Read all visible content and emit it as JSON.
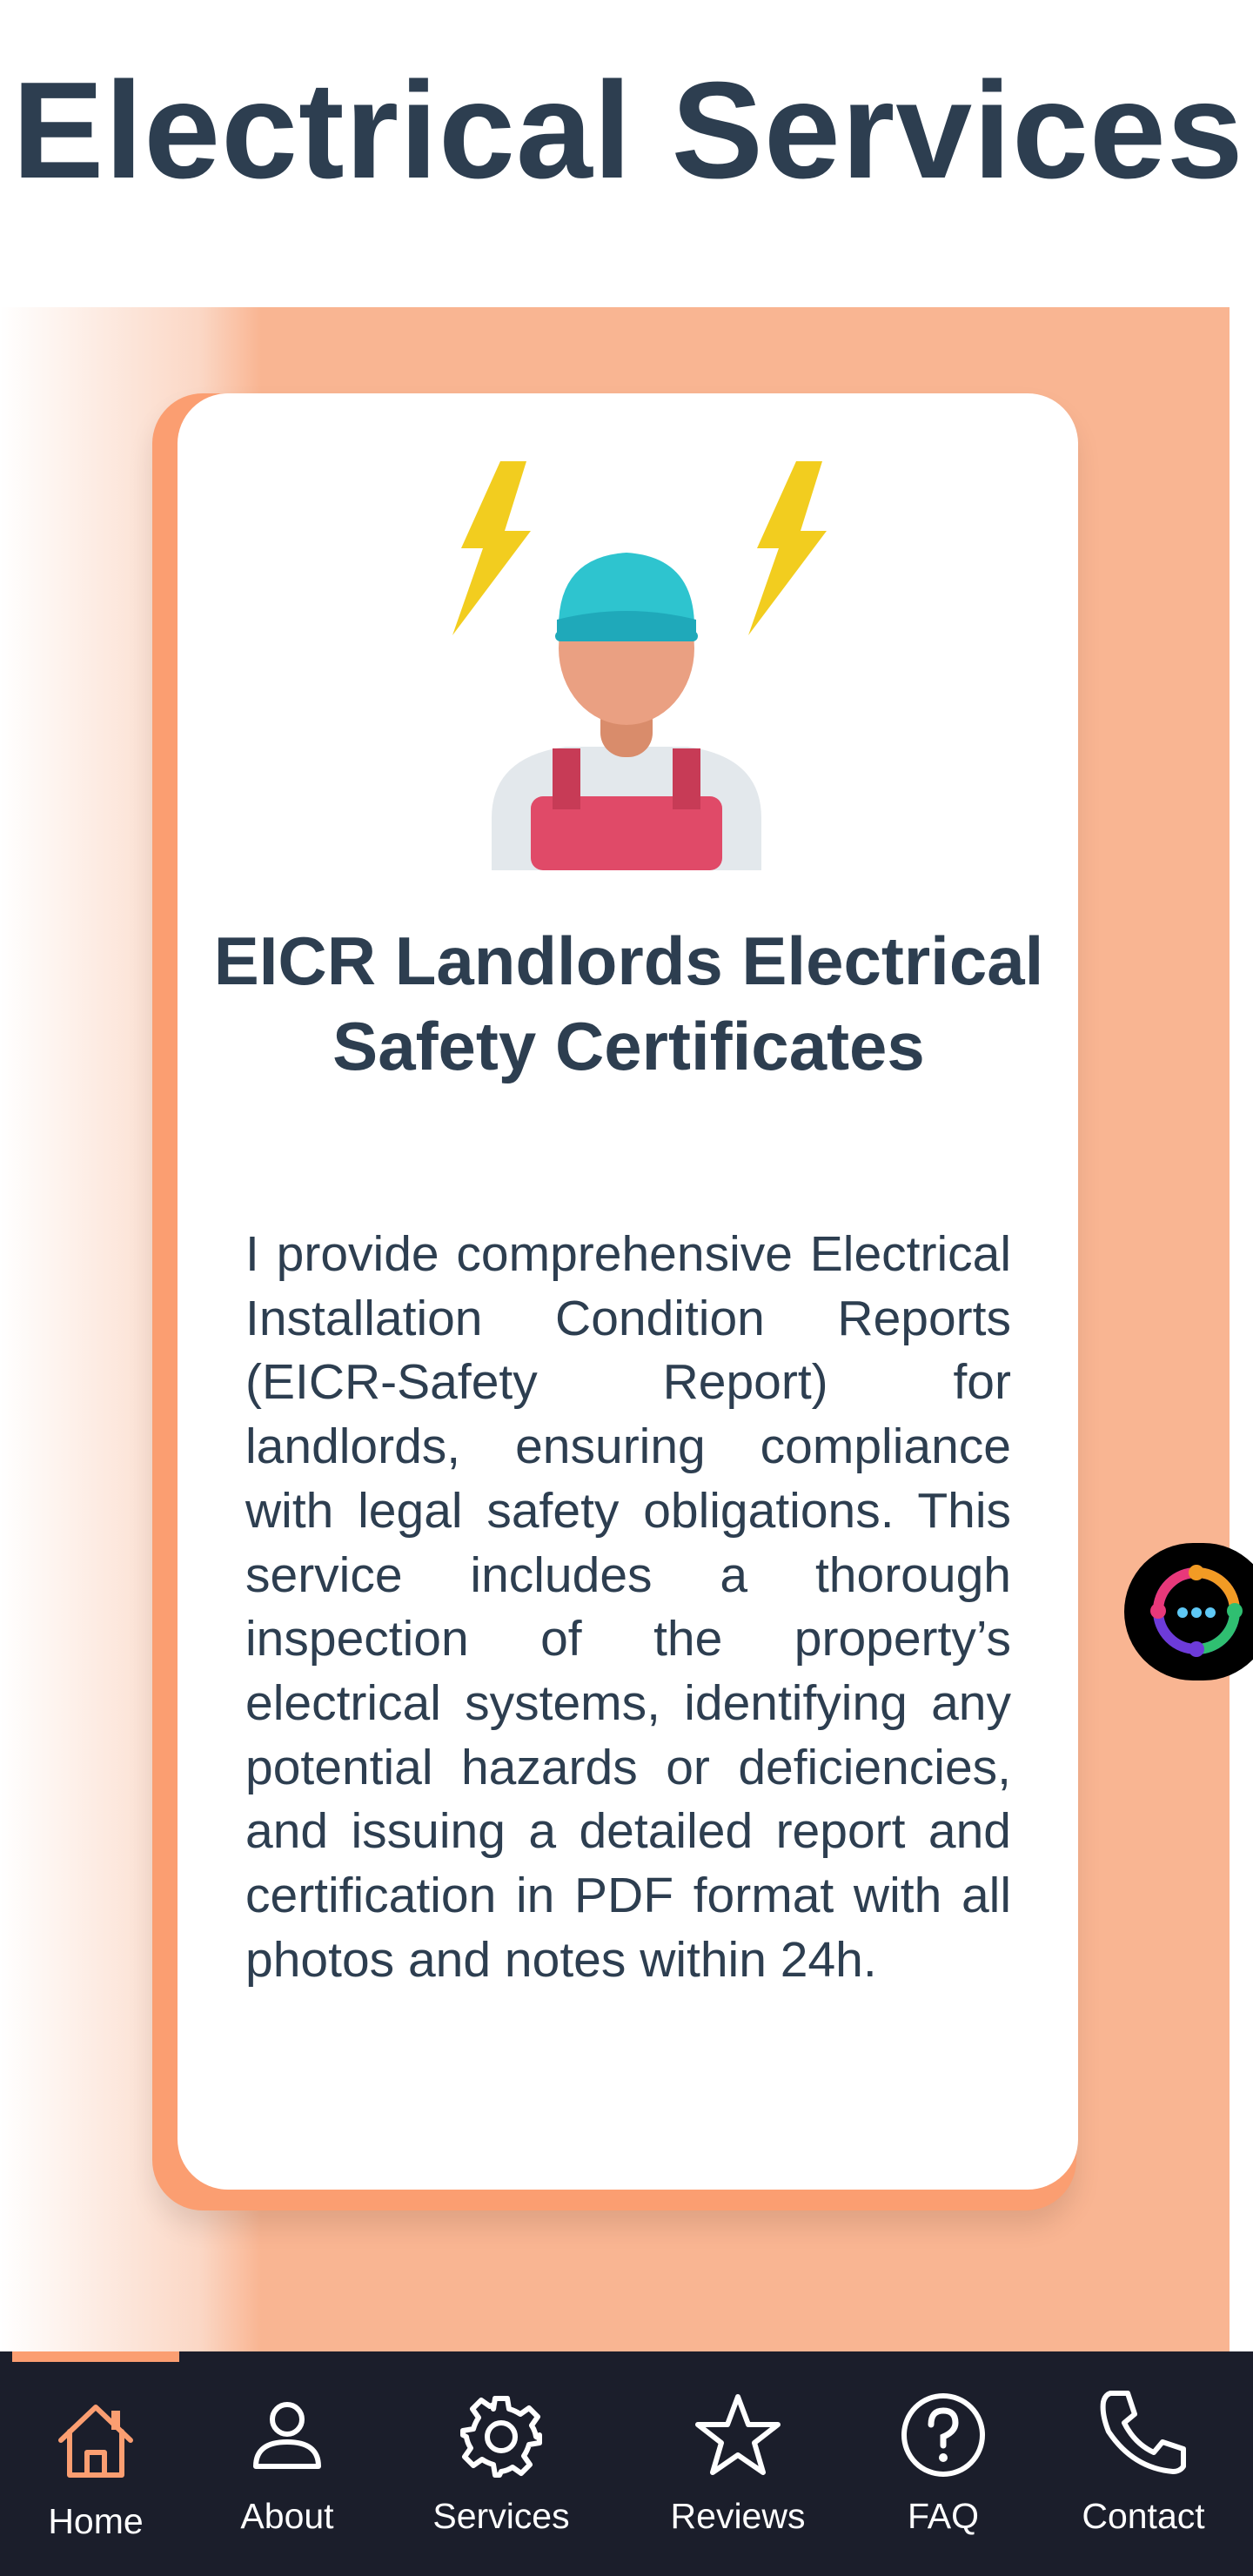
{
  "page": {
    "title": "Electrical Services"
  },
  "service_card": {
    "title": "EICR Landlords Electrical Safety Certificates",
    "description": "I provide comprehensive Electrical Installation Condition Reports (EICR-Safety Report) for landlords, ensuring compliance with legal safety obligations. This service includes a thorough inspection of the property’s electrical systems, identifying any potential hazards or deficiencies, and issuing a detailed report and certification in PDF format with all photos and notes within 24h.",
    "illustration": "electrician-icon"
  },
  "chat_widget": {
    "icon": "chat-bubble-icon"
  },
  "bottom_nav": {
    "active": "Home",
    "items": [
      {
        "label": "Home",
        "icon": "home-icon"
      },
      {
        "label": "About",
        "icon": "user-icon"
      },
      {
        "label": "Services",
        "icon": "gear-icon"
      },
      {
        "label": "Reviews",
        "icon": "star-icon"
      },
      {
        "label": "FAQ",
        "icon": "question-icon"
      },
      {
        "label": "Contact",
        "icon": "phone-icon"
      }
    ]
  },
  "colors": {
    "heading": "#2d3e50",
    "accent": "#fb9e71",
    "band": "#f9b592",
    "nav_background": "#1b1e2b"
  }
}
